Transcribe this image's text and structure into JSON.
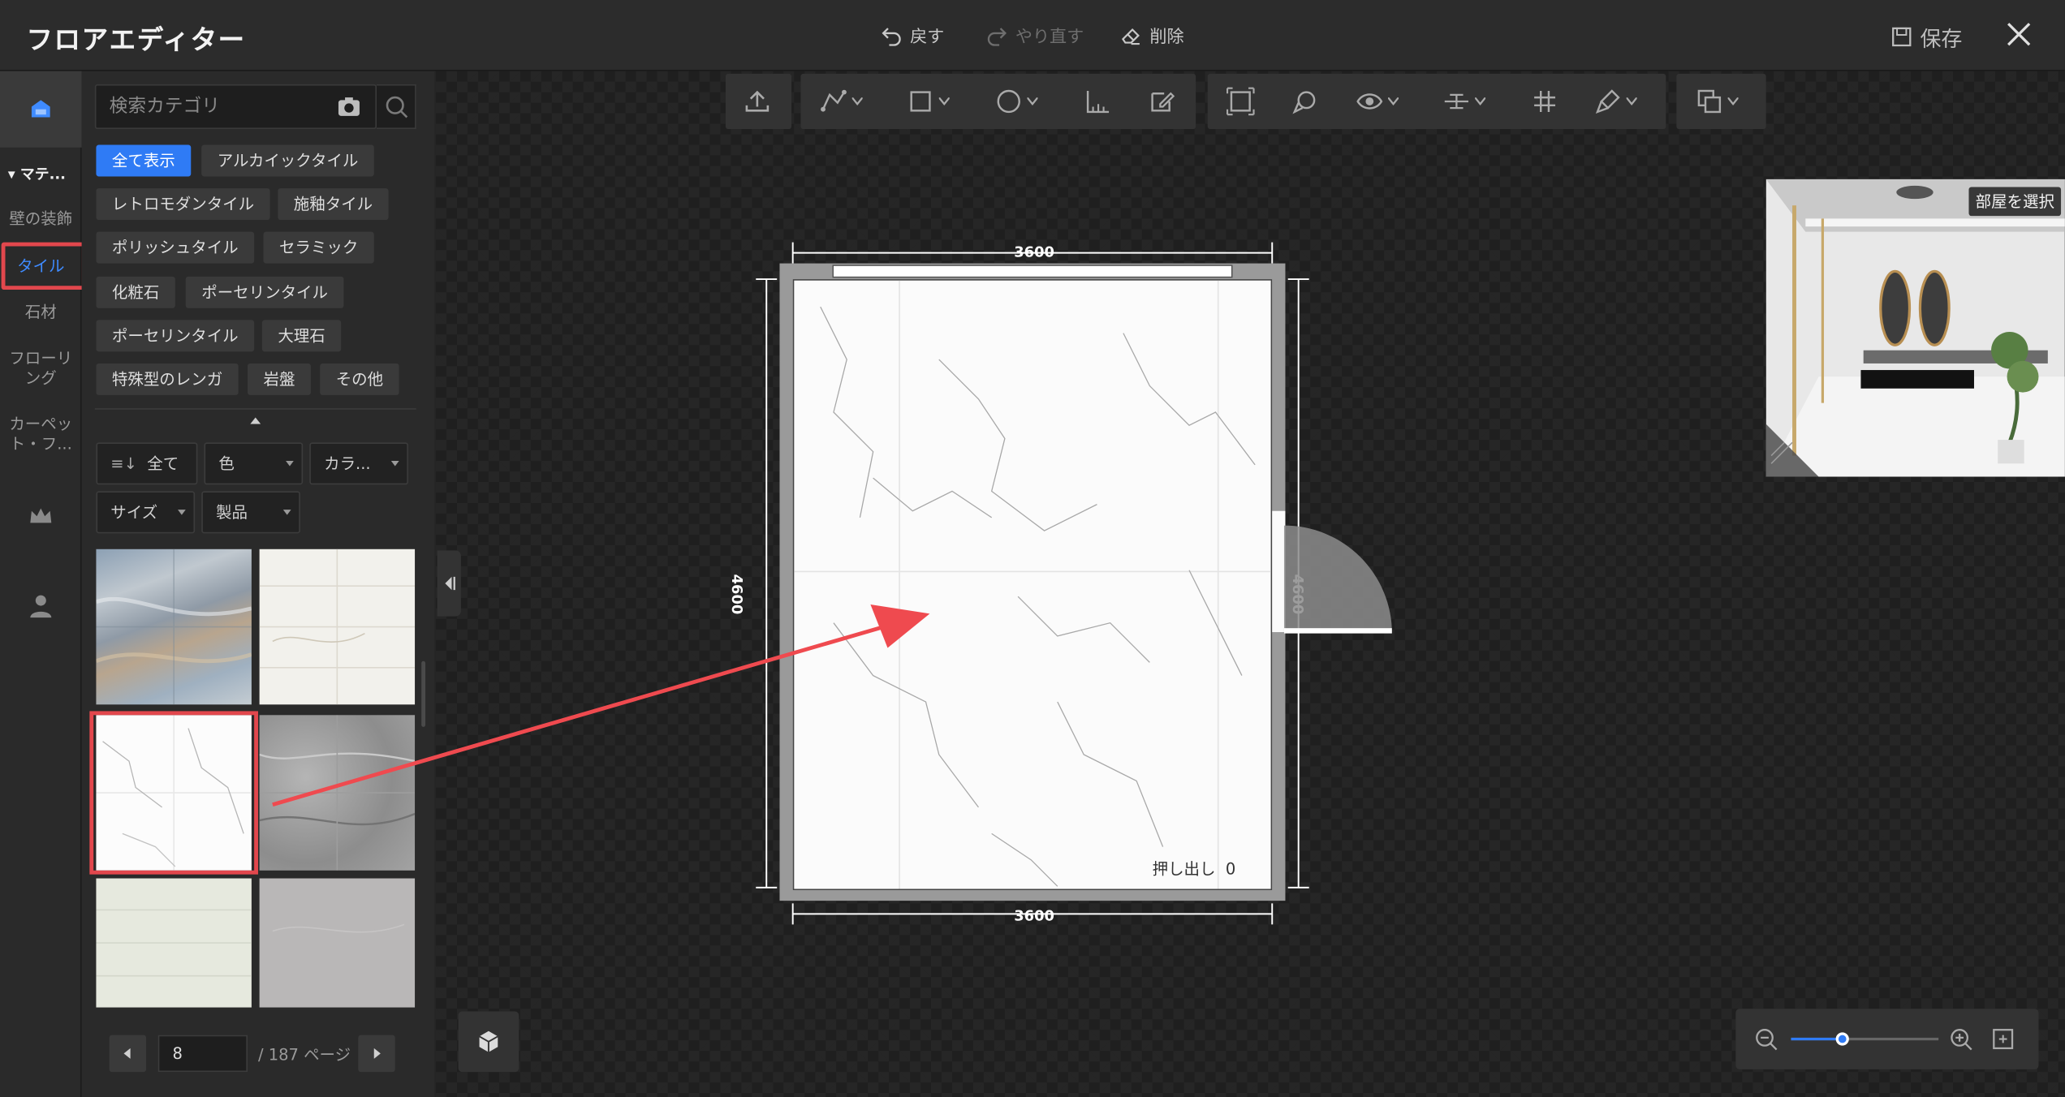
{
  "app": {
    "title": "フロアエディター"
  },
  "header": {
    "undo_label": "戻す",
    "redo_label": "やり直す",
    "delete_label": "削除",
    "save_label": "保存"
  },
  "rail": {
    "section_label": "マテ...",
    "categories": [
      "壁の装飾",
      "タイル",
      "石材",
      "フローリング",
      "カーペット・フ..."
    ],
    "selected_category": "タイル"
  },
  "panel": {
    "search_placeholder": "検索カテゴリ",
    "chips": [
      "全て表示",
      "アルカイックタイル",
      "レトロモダンタイル",
      "施釉タイル",
      "ポリッシュタイル",
      "セラミック",
      "化粧石",
      "ポーセリンタイル",
      "ポーセリンタイル",
      "大理石",
      "特殊型のレンガ",
      "岩盤",
      "その他"
    ],
    "active_chip": "全て表示",
    "filters": {
      "sort": "全て",
      "color": "色",
      "color2": "カラ...",
      "size": "サイズ",
      "product": "製品"
    },
    "pager": {
      "current_page": "8",
      "total_label": "/ 187 ページ"
    }
  },
  "canvas": {
    "dim_top": "3600",
    "dim_bottom": "3600",
    "dim_left": "4600",
    "dim_right": "4600",
    "extrude_label": "押し出し",
    "extrude_value": "0",
    "preview_button": "部屋を選択",
    "zoom_level": 0.35
  },
  "colors": {
    "accent": "#2f7bf5",
    "highlight": "#e2474d",
    "background": "#252525"
  }
}
